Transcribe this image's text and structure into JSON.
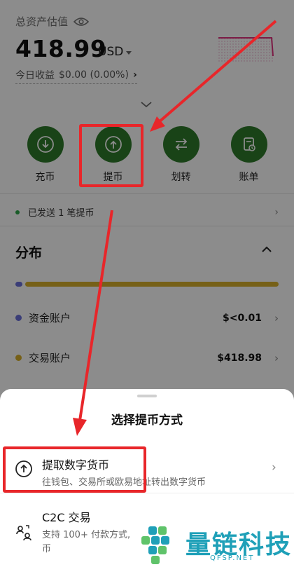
{
  "header": {
    "asset_label": "总资产估值",
    "asset_value": "418.99",
    "currency": "USD",
    "today_pnl_label": "今日收益",
    "today_pnl_value": "$0.00 (0.00%)",
    "today_pnl_arrow": "›"
  },
  "actions": [
    {
      "label": "充币",
      "icon": "download-icon"
    },
    {
      "label": "提币",
      "icon": "upload-icon"
    },
    {
      "label": "划转",
      "icon": "transfer-icon"
    },
    {
      "label": "账单",
      "icon": "bill-icon"
    }
  ],
  "notice": {
    "text": "已发送 1 笔提币",
    "chevron": "›"
  },
  "distribution": {
    "title": "分布",
    "accounts": [
      {
        "name": "资金账户",
        "value": "$<0.01",
        "color": "#6a6fd9"
      },
      {
        "name": "交易账户",
        "value": "$418.98",
        "color": "#d7b02a"
      }
    ]
  },
  "sheet": {
    "title": "选择提币方式",
    "options": [
      {
        "title": "提取数字货币",
        "subtitle": "往钱包、交易所或欧易地址转出数字货币",
        "icon": "upload-circle-icon"
      },
      {
        "title": "C2C 交易",
        "subtitle": "支持 100+ 付款方式,",
        "subtitle2": "币",
        "icon": "c2c-icon"
      }
    ]
  },
  "watermark": {
    "text": "量链科技",
    "sub": "QFSP.NET"
  },
  "colors": {
    "accent_green": "#2f7a2b",
    "annotation_red": "#e8262a",
    "fund_color": "#6a6fd9",
    "trade_color": "#d7b02a"
  }
}
